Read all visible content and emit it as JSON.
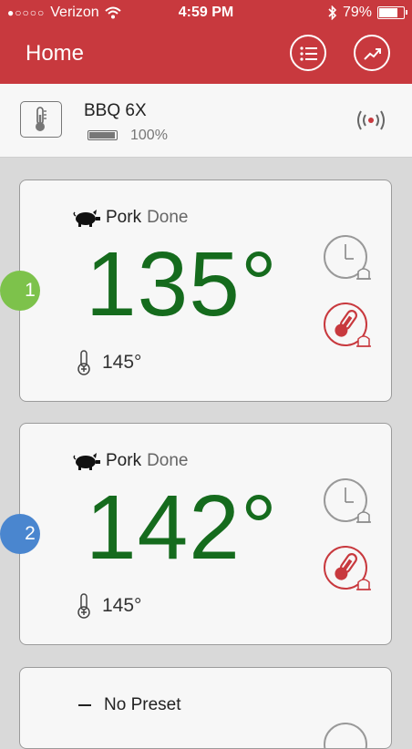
{
  "status": {
    "carrier": "Verizon",
    "time": "4:59 PM",
    "battery": "79%",
    "battery_level": 0.79
  },
  "header": {
    "title": "Home"
  },
  "device": {
    "name": "BBQ 6X",
    "battery": "100%",
    "battery_level": 1.0
  },
  "probes": [
    {
      "number": "1",
      "preset": "Pork",
      "state": "Done",
      "temp": "135°",
      "target": "145°",
      "color": "#7dc24b"
    },
    {
      "number": "2",
      "preset": "Pork",
      "state": "Done",
      "temp": "142°",
      "target": "145°",
      "color": "#4a86cf"
    }
  ],
  "probe3": {
    "preset": "No Preset"
  },
  "colors": {
    "brand": "#c8393e",
    "temp": "#156b1d",
    "alarm": "#c8393e"
  }
}
